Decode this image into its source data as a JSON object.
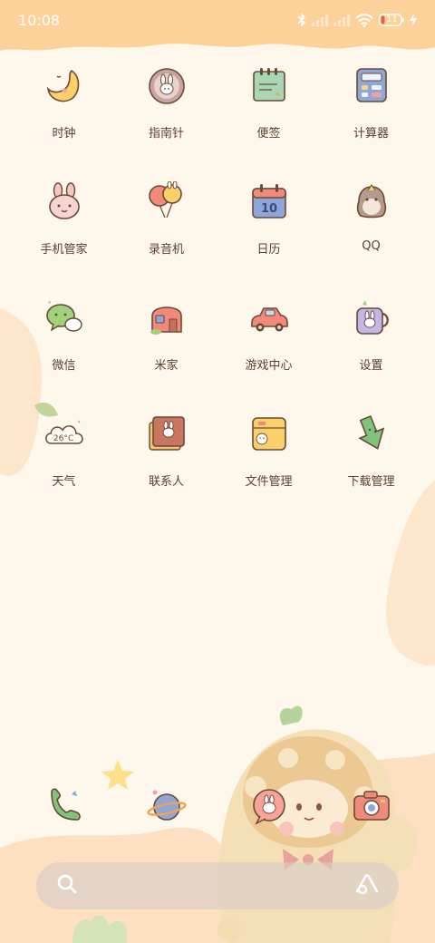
{
  "status_bar": {
    "time": "10:08",
    "battery_level": "11",
    "icons": [
      "bluetooth-icon",
      "signal-1-icon",
      "signal-2-icon",
      "wifi-icon",
      "battery-icon",
      "charging-icon"
    ]
  },
  "apps": [
    {
      "label": "时钟",
      "icon": "moon-clock-icon"
    },
    {
      "label": "指南针",
      "icon": "compass-bunny-icon"
    },
    {
      "label": "便签",
      "icon": "notepad-icon"
    },
    {
      "label": "计算器",
      "icon": "calculator-icon"
    },
    {
      "label": "手机管家",
      "icon": "bunny-security-icon"
    },
    {
      "label": "录音机",
      "icon": "balloon-recorder-icon"
    },
    {
      "label": "日历",
      "icon": "calendar-icon"
    },
    {
      "label": "QQ",
      "icon": "penguin-icon"
    },
    {
      "label": "微信",
      "icon": "chat-bubble-icon"
    },
    {
      "label": "米家",
      "icon": "house-icon"
    },
    {
      "label": "游戏中心",
      "icon": "car-icon"
    },
    {
      "label": "设置",
      "icon": "mug-icon"
    },
    {
      "label": "天气",
      "icon": "cloud-weather-icon",
      "badge_text": "26°C"
    },
    {
      "label": "联系人",
      "icon": "contacts-book-icon"
    },
    {
      "label": "文件管理",
      "icon": "folder-icon"
    },
    {
      "label": "下载管理",
      "icon": "download-arrow-icon"
    }
  ],
  "calendar_day": "10",
  "dock": [
    {
      "icon": "phone-icon"
    },
    {
      "icon": "planet-browser-icon"
    },
    {
      "icon": "bunny-message-icon"
    },
    {
      "icon": "camera-icon"
    }
  ],
  "search_bar": {
    "left_icon": "search-icon",
    "right_icon": "assistant-icon"
  },
  "colors": {
    "background": "#fef7ec",
    "header_wave": "#fdd29a",
    "label_text": "#5b3f2f",
    "search_bar": "#d6cdc6"
  }
}
